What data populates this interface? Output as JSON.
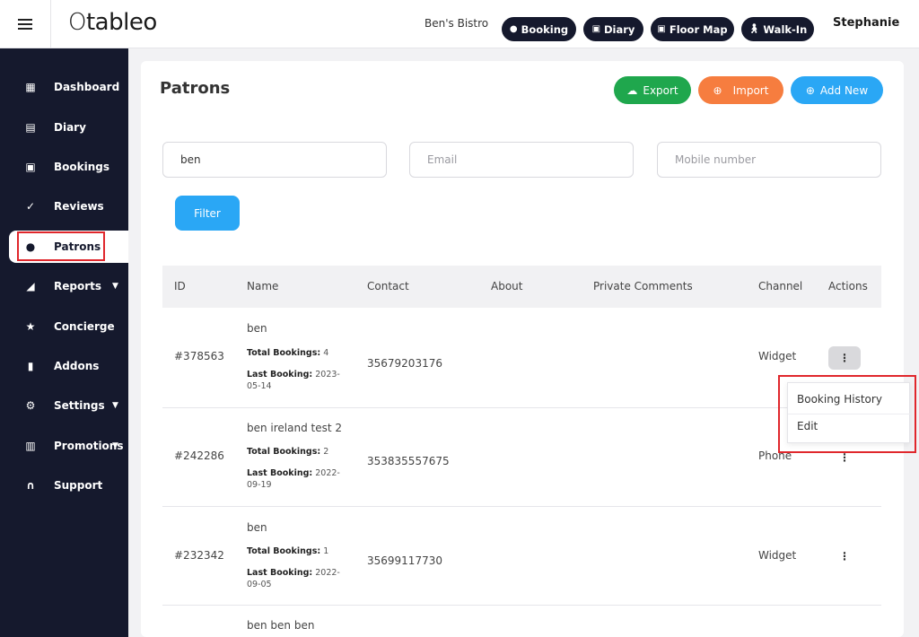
{
  "header": {
    "logo": "tableo",
    "venue": "Ben's Bistro",
    "buttons": [
      {
        "label": "Booking",
        "icon": "plus-circle-icon"
      },
      {
        "label": "Diary",
        "icon": "calendar-icon"
      },
      {
        "label": "Floor Map",
        "icon": "floor-map-icon"
      },
      {
        "label": "Walk-In",
        "icon": "walking-person-icon"
      }
    ],
    "user": "Stephanie"
  },
  "sidebar": {
    "items": [
      {
        "label": "Dashboard",
        "icon": "dashboard-icon",
        "glyph": "▦"
      },
      {
        "label": "Diary",
        "icon": "calendar-icon",
        "glyph": "▤"
      },
      {
        "label": "Bookings",
        "icon": "bookings-icon",
        "glyph": "▣"
      },
      {
        "label": "Reviews",
        "icon": "reviews-icon",
        "glyph": "✓"
      },
      {
        "label": "Patrons",
        "icon": "person-icon",
        "glyph": "●",
        "active": true
      },
      {
        "label": "Reports",
        "icon": "chart-icon",
        "glyph": "◢",
        "caret": true
      },
      {
        "label": "Concierge",
        "icon": "star-icon",
        "glyph": "★"
      },
      {
        "label": "Addons",
        "icon": "addons-icon",
        "glyph": "▮"
      },
      {
        "label": "Settings",
        "icon": "gear-icon",
        "glyph": "⚙",
        "caret": true
      },
      {
        "label": "Promotions",
        "icon": "gift-icon",
        "glyph": "▥",
        "caret": true
      },
      {
        "label": "Support",
        "icon": "headset-icon",
        "glyph": "∩"
      }
    ]
  },
  "page": {
    "title": "Patrons",
    "actions": {
      "export": {
        "label": "Export",
        "color": "#1fa74d"
      },
      "import": {
        "label": "Import",
        "color": "#f67d3f"
      },
      "add_new": {
        "label": "Add New",
        "color": "#2aa7f5"
      }
    },
    "filters": {
      "name_value": "ben",
      "email_placeholder": "Email",
      "mobile_placeholder": "Mobile number",
      "filter_label": "Filter"
    }
  },
  "table": {
    "headers": [
      "ID",
      "Name",
      "Contact",
      "About",
      "Private Comments",
      "Channel",
      "Actions"
    ],
    "total_bookings_label": "Total Bookings:",
    "last_booking_label": "Last Booking:",
    "rows": [
      {
        "id": "#378563",
        "name": "ben",
        "total_bookings": "4",
        "last_booking": "2023-05-14",
        "contact": "35679203176",
        "channel": "Widget"
      },
      {
        "id": "#242286",
        "name": "ben ireland test 2",
        "total_bookings": "2",
        "last_booking": "2022-09-19",
        "contact": "353835557675",
        "channel": "Phone"
      },
      {
        "id": "#232342",
        "name": "ben",
        "total_bookings": "1",
        "last_booking": "2022-09-05",
        "contact": "35699117730",
        "channel": "Widget"
      },
      {
        "id": "",
        "name": "ben ben ben",
        "total_bookings": "",
        "last_booking": "",
        "contact": "",
        "channel": ""
      }
    ]
  },
  "dropdown": {
    "items": [
      "Booking History",
      "Edit"
    ]
  },
  "colors": {
    "sidebar_bg": "#15192d",
    "highlight_red": "#e0272c"
  }
}
